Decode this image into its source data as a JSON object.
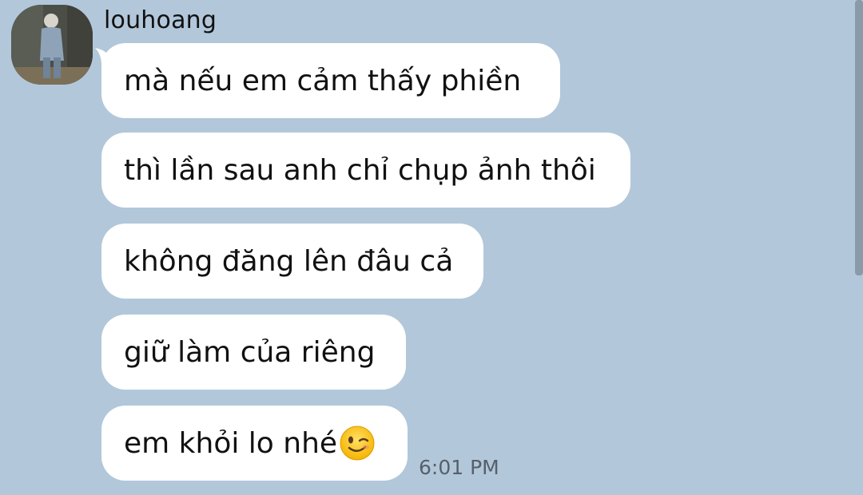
{
  "chat": {
    "sender_name": "louhoang",
    "messages": [
      {
        "text": "mà nếu em cảm thấy phiền"
      },
      {
        "text": "thì lần sau anh chỉ chụp ảnh thôi"
      },
      {
        "text": "không đăng lên đâu cả"
      },
      {
        "text": "giữ làm của riêng"
      },
      {
        "text": "em khỏi lo nhé",
        "emoji": "winking-face-emoji"
      }
    ],
    "timestamp": "6:01 PM"
  },
  "colors": {
    "background": "#b2c7da",
    "bubble": "#ffffff",
    "timestamp": "#56606b"
  }
}
